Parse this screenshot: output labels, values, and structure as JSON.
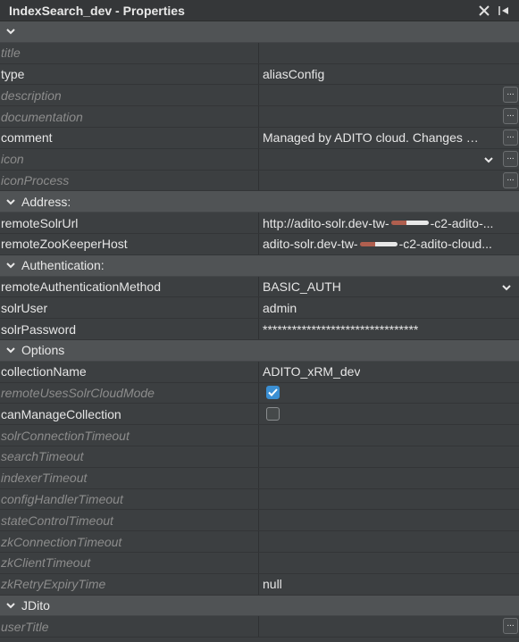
{
  "window": {
    "title": "IndexSearch_dev - Properties",
    "close_icon": "close-icon",
    "minimize_icon": "minimize-icon"
  },
  "groups": {
    "top": "",
    "address": "Address:",
    "authentication": "Authentication:",
    "options": "Options",
    "jdito": "JDito"
  },
  "props": {
    "title": {
      "key": "title",
      "value": ""
    },
    "type": {
      "key": "type",
      "value": "aliasConfig"
    },
    "description": {
      "key": "description",
      "value": ""
    },
    "documentation": {
      "key": "documentation",
      "value": ""
    },
    "comment": {
      "key": "comment",
      "value": "Managed by ADITO cloud. Changes will be overwritten"
    },
    "icon": {
      "key": "icon",
      "value": ""
    },
    "iconProcess": {
      "key": "iconProcess",
      "value": ""
    },
    "remoteSolrUrl": {
      "key": "remoteSolrUrl",
      "value_start": "http://adito-solr.dev-tw-",
      "value_end": "-c2-adito-..."
    },
    "remoteZooKeeperHost": {
      "key": "remoteZooKeeperHost",
      "value_start": "adito-solr.dev-tw-",
      "value_end": "-c2-adito-cloud..."
    },
    "remoteAuthenticationMethod": {
      "key": "remoteAuthenticationMethod",
      "value": "BASIC_AUTH"
    },
    "solrUser": {
      "key": "solrUser",
      "value": "admin"
    },
    "solrPassword": {
      "key": "solrPassword",
      "value": "********************************"
    },
    "collectionName": {
      "key": "collectionName",
      "value": "ADITO_xRM_dev"
    },
    "remoteUsesSolrCloudMode": {
      "key": "remoteUsesSolrCloudMode",
      "checked": true
    },
    "canManageCollection": {
      "key": "canManageCollection",
      "checked": false
    },
    "solrConnectionTimeout": {
      "key": "solrConnectionTimeout",
      "value": ""
    },
    "searchTimeout": {
      "key": "searchTimeout",
      "value": ""
    },
    "indexerTimeout": {
      "key": "indexerTimeout",
      "value": ""
    },
    "configHandlerTimeout": {
      "key": "configHandlerTimeout",
      "value": ""
    },
    "stateControlTimeout": {
      "key": "stateControlTimeout",
      "value": ""
    },
    "zkConnectionTimeout": {
      "key": "zkConnectionTimeout",
      "value": ""
    },
    "zkClientTimeout": {
      "key": "zkClientTimeout",
      "value": ""
    },
    "zkRetryExpiryTime": {
      "key": "zkRetryExpiryTime",
      "value": "null"
    },
    "userTitle": {
      "key": "userTitle",
      "value": ""
    }
  },
  "ellipsis_label": "...",
  "colors": {
    "background": "#3c3f41",
    "group_header": "#505355",
    "checkbox_accent": "#3b8fd3",
    "default_text": "#8c8c8c"
  }
}
